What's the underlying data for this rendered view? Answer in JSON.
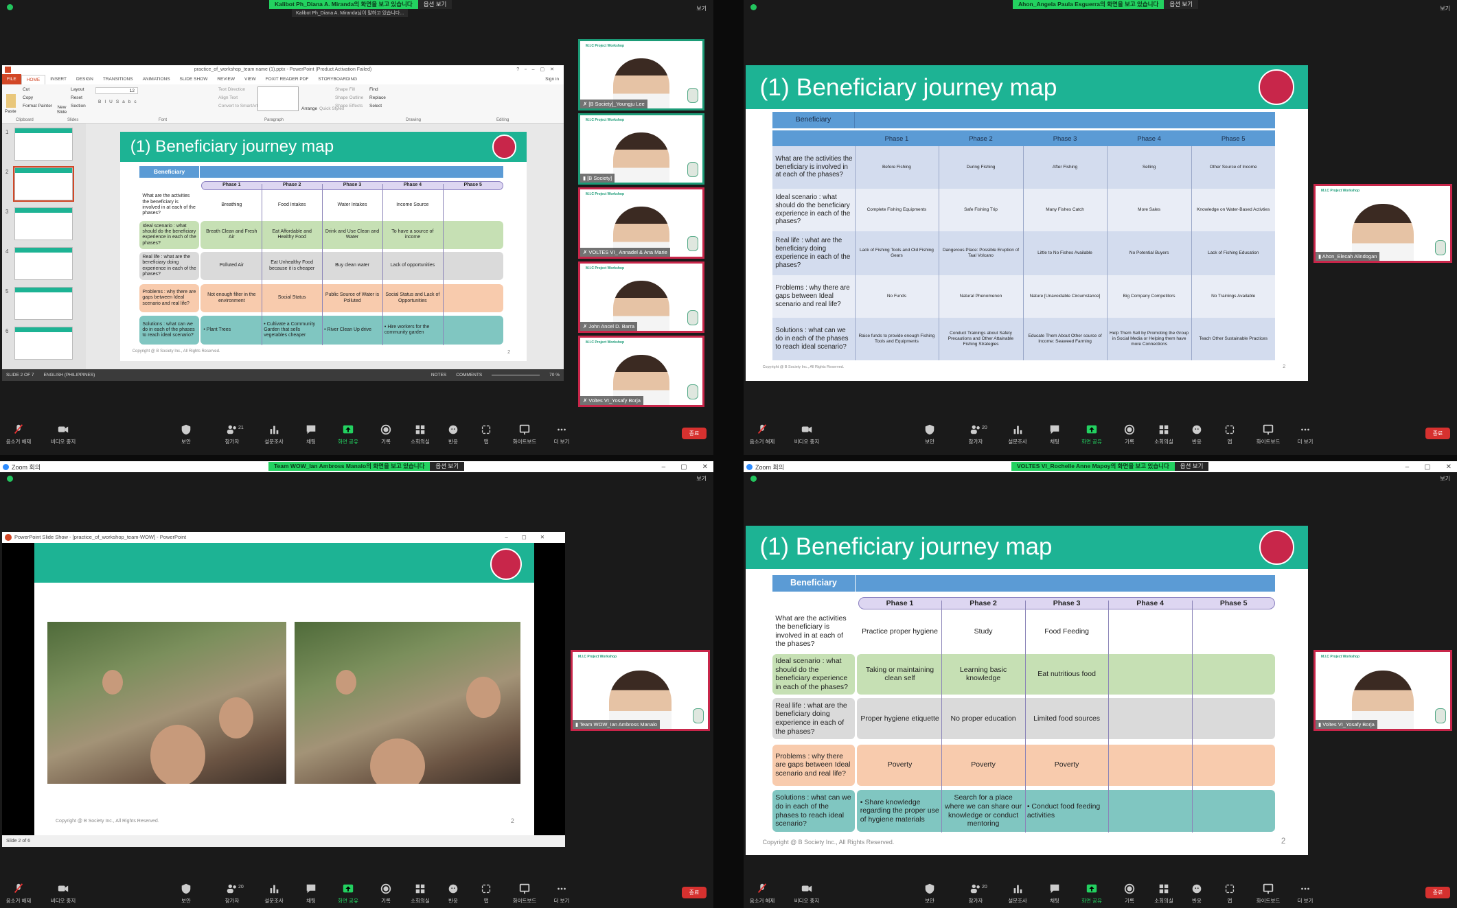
{
  "toolbar": {
    "items": [
      {
        "label": "음소거 해제",
        "icon": "mic-muted-icon"
      },
      {
        "label": "비디오 중지",
        "icon": "video-camera-icon"
      },
      {
        "label": "보안",
        "icon": "shield-icon"
      },
      {
        "label": "참가자",
        "icon": "participants-icon"
      },
      {
        "label": "설문조사",
        "icon": "poll-icon"
      },
      {
        "label": "채팅",
        "icon": "chat-icon"
      },
      {
        "label": "화면 공유",
        "icon": "share-screen-icon"
      },
      {
        "label": "기록",
        "icon": "record-icon"
      },
      {
        "label": "소회의실",
        "icon": "breakout-rooms-icon"
      },
      {
        "label": "반응",
        "icon": "reactions-icon"
      },
      {
        "label": "앱",
        "icon": "apps-icon"
      },
      {
        "label": "화이트보드",
        "icon": "whiteboard-icon"
      },
      {
        "label": "더 보기",
        "icon": "more-icon"
      }
    ],
    "end_label": "종료"
  },
  "common": {
    "view_label": "보기",
    "option_label": "옵션 보기",
    "zoom_window_title": "Zoom 회의",
    "colors": {
      "share_banner": "#23d160",
      "slide_header": "#1db394",
      "end_button": "#d6312f"
    }
  },
  "q1": {
    "banner": "Kalibot Ph_Diana A. Miranda의 화면을 보고 있습니다",
    "speaking": "Kalibot Ph_Diana A. Miranda님이 말하고 있습니다...",
    "participants_count": "21",
    "ppt": {
      "title": "practice_of_workshop_team name (1).pptx - PowerPoint (Product Activation Failed)",
      "sign_in": "Sign in",
      "tabs": [
        "FILE",
        "HOME",
        "INSERT",
        "DESIGN",
        "TRANSITIONS",
        "ANIMATIONS",
        "SLIDE SHOW",
        "REVIEW",
        "VIEW",
        "FOXIT READER PDF",
        "STORYBOARDING"
      ],
      "ribbon": {
        "paste": "Paste",
        "cut": "Cut",
        "copy": "Copy",
        "format_painter": "Format Painter",
        "new_slide": "New Slide",
        "layout": "Layout",
        "reset": "Reset",
        "section": "Section",
        "text_direction": "Text Direction",
        "align_text": "Align Text",
        "convert_smartart": "Convert to SmartArt",
        "arrange": "Arrange",
        "quick_styles": "Quick Styles",
        "shape_fill": "Shape Fill",
        "shape_outline": "Shape Outline",
        "shape_effects": "Shape Effects",
        "find": "Find",
        "replace": "Replace",
        "select": "Select",
        "font_size": "12"
      },
      "groups": [
        "Clipboard",
        "Slides",
        "Font",
        "Paragraph",
        "Drawing",
        "Editing"
      ],
      "thumb_numbers": [
        "1",
        "2",
        "3",
        "4",
        "5",
        "6"
      ],
      "status": {
        "slide": "SLIDE 2 OF 7",
        "language": "ENGLISH (PHILIPPINES)",
        "notes": "NOTES",
        "comments": "COMMENTS",
        "zoom": "70 %"
      }
    },
    "slide": {
      "title": "(1) Beneficiary journey map",
      "beneficiary": "Beneficiary",
      "phases": [
        "Phase 1",
        "Phase 2",
        "Phase 3",
        "Phase 4",
        "Phase 5"
      ],
      "rows": [
        {
          "label": "What are the activities the beneficiary is involved in at each of the phases?",
          "cells": [
            "Breathing",
            "Food Intakes",
            "Water Intakes",
            "Income Source",
            ""
          ]
        },
        {
          "label": "Ideal scenario : what should do the beneficiary experience in each of the phases?",
          "cells": [
            "Breath Clean  and Fresh Air",
            "Eat Affordable  and Healthy Food",
            "Drink and Use Clean and Water",
            "To have  a source of income",
            ""
          ]
        },
        {
          "label": "Real life : what are the beneficiary doing experience in each of the phases?",
          "cells": [
            "Polluted Air",
            "Eat Unhealthy Food because it is cheaper",
            "Buy clean water",
            "Lack of opportunities",
            ""
          ]
        },
        {
          "label": "Problems : why there are gaps between Ideal scenario and real life?",
          "cells": [
            "Not enough filter in the environment",
            "Social Status",
            "Public Source of Water is Polluted",
            "Social Status and Lack of Opportunities",
            ""
          ]
        },
        {
          "label": "Solutions : what can we do in each of the phases to reach ideal scenario?",
          "cells": [
            "• Plant Trees",
            "• Cultivate a Community Garden that sells vegetables cheaper",
            "• River Clean Up drive",
            "• Hire workers for the community garden",
            ""
          ]
        }
      ],
      "copyright": "Copyright @ B Society Inc., All Rights Reserved.",
      "page": "2"
    },
    "tiles": [
      {
        "name": "[B Society]_Youngju Lee",
        "border": "green",
        "muted": true
      },
      {
        "name": "[B Society]",
        "border": "green",
        "muted": false
      },
      {
        "name": "VOLTES VI_ Annadel & Ana Marie",
        "border": "red",
        "muted": true
      },
      {
        "name": "John Ancel D. Barra",
        "border": "red",
        "muted": true
      },
      {
        "name": "Voltes VI_Yosafy Borja",
        "border": "red",
        "muted": true
      }
    ],
    "tile_header": "M.I.C Project Workshop"
  },
  "q2": {
    "banner": "Ahon_Angela Paula Esguerra의 화면을 보고 있습니다",
    "participants_count": "20",
    "slide": {
      "title": "(1) Beneficiary journey map",
      "beneficiary": "Beneficiary",
      "phases": [
        "Phase 1",
        "Phase 2",
        "Phase 3",
        "Phase 4",
        "Phase 5"
      ],
      "rows": [
        {
          "label": "What are the activities the beneficiary is involved in at each of the phases?",
          "cells": [
            "Before Fishing",
            "During Fishing",
            "After Fishing",
            "Selling",
            "Other Source of Income"
          ]
        },
        {
          "label": "Ideal scenario : what should do the beneficiary experience in each of the phases?",
          "cells": [
            "Complete Fishing Equipments",
            "Safe Fishing Trip",
            "Many Fishes Catch",
            "More Sales",
            "Knowledge on Water-Based Activties"
          ]
        },
        {
          "label": "Real life : what are the beneficiary doing experience in each of the phases?",
          "cells": [
            "Lack of Fishing Tools and Old Fishing Gears",
            "Dangerous Place: Possible Eruption of Taal Volcano",
            "Little to No Fishes Available",
            "No Potential Buyers",
            "Lack of Fishing Education"
          ]
        },
        {
          "label": "Problems : why there are gaps between Ideal scenario and real life?",
          "cells": [
            "No Funds",
            "Natural Phenomenon",
            "Nature [Unavoidable Circumstance]",
            "Big Company Competitors",
            "No Trainings Available"
          ]
        },
        {
          "label": "Solutions : what can we do in each of the phases to reach ideal scenario?",
          "cells": [
            "Raise funds to provide enough Fishing Tools and Equipments",
            "Conduct Trainings about Safety Precautions and Other Attainable Fishing Strategies",
            "Educate Them About Other source of Income: Seaweed Farming",
            "Help Them Sell by Promoting the Group in Social Media or Helping them have more Connections",
            "Teach Other Sustainable Practices"
          ]
        }
      ],
      "copyright": "Copyright @ B Society Inc., All Rights Reserved.",
      "page": "2"
    },
    "tile": {
      "name": "Ahon_Elecah Alindogan",
      "border": "red"
    }
  },
  "q3": {
    "banner": "Team WOW_Ian Ambross Manalo의 화면을 보고 있습니다",
    "participants_count": "20",
    "slideshow_title": "PowerPoint Slide Show - [practice_of_workshop_team-WOW] - PowerPoint",
    "status": "Slide 2 of 6",
    "copyright": "Copyright @ B Society Inc., All Rights Reserved.",
    "page": "2",
    "tile": {
      "name": "Team WOW_Ian Ambross Manalo",
      "border": "red"
    }
  },
  "q4": {
    "banner": "VOLTES VI_Rochelle Anne Mapoy의 화면을 보고 있습니다",
    "participants_count": "20",
    "slide": {
      "title": "(1) Beneficiary journey map",
      "beneficiary": "Beneficiary",
      "phases": [
        "Phase 1",
        "Phase 2",
        "Phase 3",
        "Phase 4",
        "Phase 5"
      ],
      "rows": [
        {
          "label": "What are the activities the beneficiary is involved in at each of the phases?",
          "cells": [
            "Practice proper hygiene",
            "Study",
            "Food Feeding",
            "",
            ""
          ]
        },
        {
          "label": "Ideal scenario : what should do the beneficiary experience in each of the phases?",
          "cells": [
            "Taking or maintaining clean self",
            "Learning basic knowledge",
            "Eat nutritious food",
            "",
            ""
          ]
        },
        {
          "label": "Real life : what are the beneficiary doing experience in each of the phases?",
          "cells": [
            "Proper hygiene etiquette",
            "No proper education",
            "Limited food sources",
            "",
            ""
          ]
        },
        {
          "label": "Problems : why there are gaps between Ideal scenario and real life?",
          "cells": [
            "Poverty",
            "Poverty",
            "Poverty",
            "",
            ""
          ]
        },
        {
          "label": "Solutions : what can we do in each of the phases to reach ideal scenario?",
          "cells": [
            "• Share knowledge regarding the proper use of hygiene materials",
            "Search for a place where we can share our knowledge or conduct mentoring",
            "• Conduct food feeding activities",
            "",
            ""
          ]
        }
      ],
      "copyright": "Copyright @ B Society Inc., All Rights Reserved.",
      "page": "2"
    },
    "tile": {
      "name": "Voltes VI_Yosafy Borja",
      "border": "red"
    }
  }
}
